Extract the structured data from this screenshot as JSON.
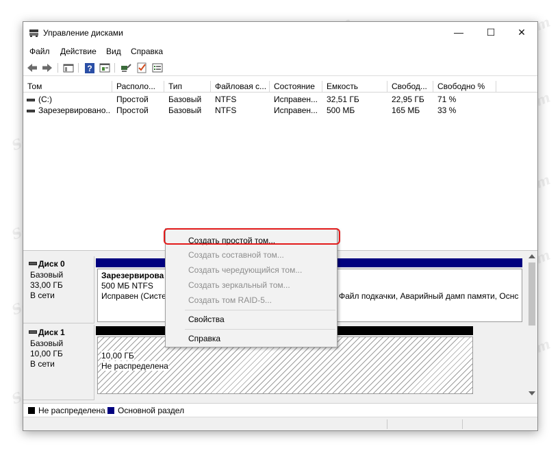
{
  "window": {
    "title": "Управление дисками",
    "min": "—",
    "max": "☐",
    "close": "✕"
  },
  "menu": [
    "Файл",
    "Действие",
    "Вид",
    "Справка"
  ],
  "toolbar_icons": [
    "back-icon",
    "forward-icon",
    "console-tree-icon",
    "help-icon",
    "properties-icon",
    "connect-icon",
    "check-icon",
    "list-icon"
  ],
  "table": {
    "columns": [
      "Том",
      "Располо...",
      "Тип",
      "Файловая с...",
      "Состояние",
      "Емкость",
      "Свобод...",
      "Свободно %"
    ],
    "rows": [
      [
        "(C:)",
        "Простой",
        "Базовый",
        "NTFS",
        "Исправен...",
        "32,51 ГБ",
        "22,95 ГБ",
        "71 %"
      ],
      [
        "Зарезервировано...",
        "Простой",
        "Базовый",
        "NTFS",
        "Исправен...",
        "500 МБ",
        "165 МБ",
        "33 %"
      ]
    ]
  },
  "disks": [
    {
      "name": "Диск 0",
      "type": "Базовый",
      "size": "33,00 ГБ",
      "status": "В сети",
      "partition": {
        "label": "Зарезервирова",
        "size_fs": "500 МБ NTFS",
        "status": "Исправен (Систе"
      },
      "partition2_status": "Файл подкачки, Аварийный дамп памяти, Оснс"
    },
    {
      "name": "Диск 1",
      "type": "Базовый",
      "size": "10,00 ГБ",
      "status": "В сети",
      "partition": {
        "size": "10,00 ГБ",
        "state": "Не распределена"
      }
    }
  ],
  "legend": [
    {
      "label": "Не распределена",
      "color": "#000000"
    },
    {
      "label": "Основной раздел",
      "color": "#00007f"
    }
  ],
  "context_menu": [
    {
      "label": "Создать простой том...",
      "enabled": true
    },
    {
      "label": "Создать составной том...",
      "enabled": false
    },
    {
      "label": "Создать чередующийся том...",
      "enabled": false
    },
    {
      "label": "Создать зеркальный том...",
      "enabled": false
    },
    {
      "label": "Создать том RAID-5...",
      "enabled": false
    },
    {
      "label": "Свойства",
      "enabled": true
    },
    {
      "label": "Справка",
      "enabled": true
    }
  ],
  "watermark": "Soringpcrepair.com",
  "colors": {
    "primary_partition": "#00007f",
    "unallocated": "#000000",
    "highlight": "#e31a1a"
  }
}
